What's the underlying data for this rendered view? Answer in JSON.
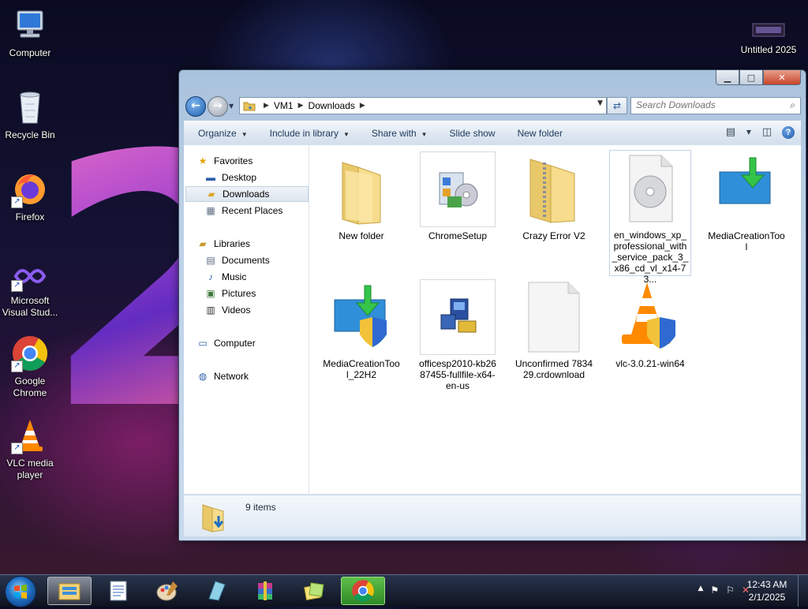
{
  "desktop": {
    "icons": [
      {
        "label": "Computer"
      },
      {
        "label": "Recycle Bin"
      },
      {
        "label": "Firefox"
      },
      {
        "label": "Microsoft Visual Stud..."
      },
      {
        "label": "Google Chrome"
      },
      {
        "label": "VLC media player"
      },
      {
        "label": "Untitled 2025"
      }
    ]
  },
  "window": {
    "min_symbol": "▁",
    "max_symbol": "□",
    "close_symbol": "✕",
    "breadcrumb": [
      "VM1",
      "Downloads"
    ],
    "search_placeholder": "Search Downloads",
    "toolbar": {
      "organize": "Organize",
      "include_in_library": "Include in library",
      "share_with": "Share with",
      "slide_show": "Slide show",
      "new_folder": "New folder"
    },
    "nav": {
      "favorites": "Favorites",
      "desktop": "Desktop",
      "downloads": "Downloads",
      "recent_places": "Recent Places",
      "libraries": "Libraries",
      "documents": "Documents",
      "music": "Music",
      "pictures": "Pictures",
      "videos": "Videos",
      "computer": "Computer",
      "network": "Network"
    },
    "files": [
      {
        "name": "New folder",
        "type": "folder"
      },
      {
        "name": "ChromeSetup",
        "type": "setup"
      },
      {
        "name": "Crazy Error V2",
        "type": "zip-folder"
      },
      {
        "name": "en_windows_xp_professional_with_service_pack_3_x86_cd_vl_x14-73...",
        "type": "disc-image"
      },
      {
        "name": "MediaCreationTool",
        "type": "media-tool"
      },
      {
        "name": "MediaCreationTool_22H2",
        "type": "media-tool-shield"
      },
      {
        "name": "officesp2010-kb2687455-fullfile-x64-en-us",
        "type": "installer"
      },
      {
        "name": "Unconfirmed 783429.crdownload",
        "type": "blank"
      },
      {
        "name": "vlc-3.0.21-win64",
        "type": "vlc"
      }
    ],
    "status": {
      "item_count": "9 items"
    }
  },
  "taskbar": {
    "time": "12:43 AM",
    "date": "2/1/2025"
  }
}
